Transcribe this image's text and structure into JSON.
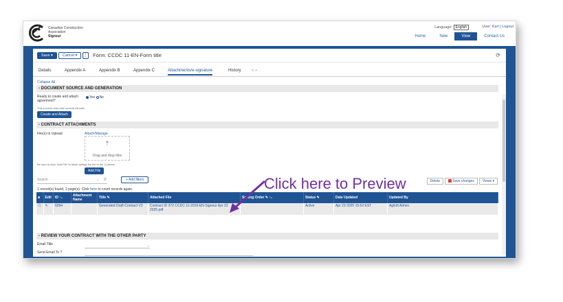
{
  "header": {
    "org_line1": "Canadian Construction",
    "org_line2": "Association",
    "org_line3": "Signeur",
    "language_label": "Language:",
    "language_value": "English",
    "user_label": "User:",
    "user_name": "Karl",
    "logout_label": "Logout",
    "nav": [
      "Home",
      "New",
      "View",
      "Contact Us"
    ],
    "active_nav": "View"
  },
  "toolbar": {
    "save_label": "Save",
    "cancel_label": "Cancel",
    "more_label": "⋮",
    "form_title": "Form: CCDC 11-EN-Form title"
  },
  "tabs": [
    "Details",
    "Appendix A",
    "Appendix B",
    "Appendix C",
    "Attachments/e-signature",
    "History"
  ],
  "active_tab": "Attachments/e-signature",
  "tab_next": "« »",
  "content": {
    "collapse_all": "Collapse All",
    "section1": "- DOCUMENT SOURCE AND GENERATION",
    "ready_label": "Ready to create and attach agreement?",
    "yes_label": "Yes",
    "no_label": "No",
    "process_note": "This process may take several minutes",
    "create_attach": "Create and Attach",
    "section2": "- CONTRACT ATTACHMENTS",
    "files_label": "File(s) to Upload",
    "attach_manage": "Attach/Manage",
    "drop_text": "Drag and drop files",
    "add_file_note": "Be sure to click 'Add File' to finish adding the file to the Contract.",
    "add_file": "Add File",
    "search_placeholder": "Search",
    "add_filters": "+ Add filters",
    "records_text": "1 record(s) found, 1 page(s). Click",
    "records_link": "here",
    "records_tail": "to count records again.",
    "delete_btn": "Delete",
    "save_changes_btn": "Save changes",
    "views_btn": "Views ▾",
    "columns": [
      "■",
      "Edit",
      "ID ↑₁",
      "Attachment Name",
      "Title ✎",
      "Attached File",
      "Sorting Order ✎ ↑₂",
      "Status ✎",
      "Date Updated",
      "Updated By"
    ],
    "rows": [
      [
        "☐",
        "✎",
        "6094",
        "",
        "Generated Draft Contract V2",
        "Contract ID 372 CCDC 11-2019-EN-Signeur Apr 23 2025.pdf",
        "",
        "Active",
        "Apr 23 2025 15:52 EST",
        "Agiloft Admin"
      ]
    ],
    "section3": "- REVIEW YOUR CONTRACT WITH THE OTHER PARTY",
    "email_title": "Email Title",
    "send_email_to": "Send Email To"
  },
  "callout": "Click here to Preview",
  "colors": {
    "brand_blue": "#1f5394",
    "callout_purple": "#7030a0"
  }
}
